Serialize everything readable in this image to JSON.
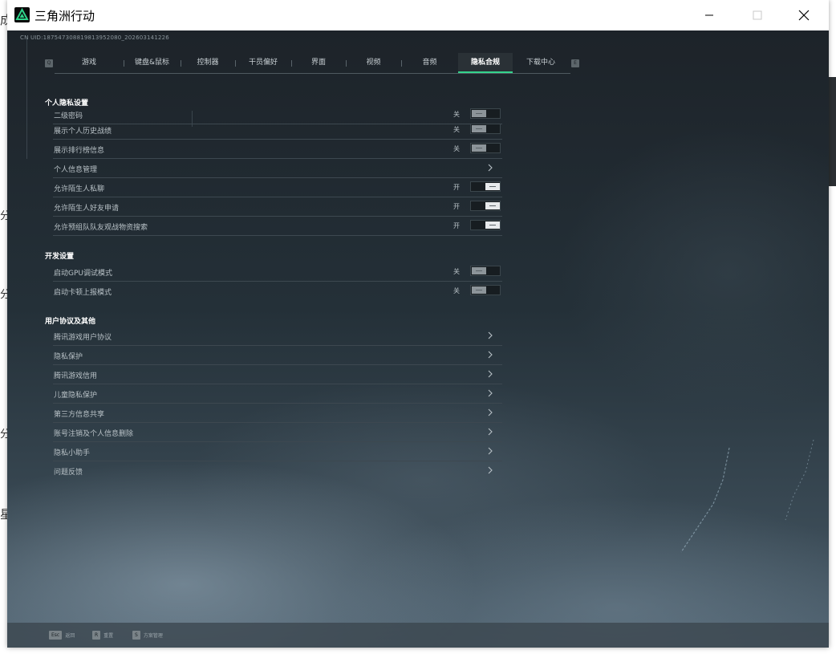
{
  "window": {
    "title": "三角洲行动"
  },
  "header": {
    "uid": "CN UID:18754730881981395208​0_2026031412​26"
  },
  "tabs": {
    "left_key": "Q",
    "right_key": "E",
    "items": [
      {
        "label": "游戏"
      },
      {
        "label": "键盘&鼠标"
      },
      {
        "label": "控制器"
      },
      {
        "label": "干员偏好"
      },
      {
        "label": "界面"
      },
      {
        "label": "视频"
      },
      {
        "label": "音频"
      },
      {
        "label": "隐私合规",
        "active": true
      },
      {
        "label": "下载中心"
      }
    ]
  },
  "sections": {
    "privacy": {
      "title": "个人隐私设置",
      "items": [
        {
          "label": "二级密码",
          "state": "关",
          "type": "toggle",
          "on": false
        },
        {
          "label": "展示个人历史战绩",
          "state": "关",
          "type": "toggle",
          "on": false
        },
        {
          "label": "展示排行榜信息",
          "state": "关",
          "type": "toggle",
          "on": false
        },
        {
          "label": "个人信息管理",
          "type": "link"
        },
        {
          "label": "允许陌生人私聊",
          "state": "开",
          "type": "toggle",
          "on": true
        },
        {
          "label": "允许陌生人好友申请",
          "state": "开",
          "type": "toggle",
          "on": true
        },
        {
          "label": "允许预组队队友观战物资搜索",
          "state": "开",
          "type": "toggle",
          "on": true
        }
      ]
    },
    "dev": {
      "title": "开发设置",
      "items": [
        {
          "label": "启动GPU调试模式",
          "state": "关",
          "type": "toggle",
          "on": false
        },
        {
          "label": "启动卡顿上报模式",
          "state": "关",
          "type": "toggle",
          "on": false
        }
      ]
    },
    "agreements": {
      "title": "用户协议及其他",
      "items": [
        {
          "label": "腾讯游戏用户协议"
        },
        {
          "label": "隐私保护"
        },
        {
          "label": "腾讯游戏信用"
        },
        {
          "label": "儿童隐私保护"
        },
        {
          "label": "第三方信息共享"
        },
        {
          "label": "账号注销及个人信息删除"
        },
        {
          "label": "隐私小助手"
        },
        {
          "label": "问题反馈"
        }
      ]
    }
  },
  "bottom": {
    "hints": [
      {
        "key": "Esc",
        "label": "返回"
      },
      {
        "key": "R",
        "label": "重置"
      },
      {
        "key": "S",
        "label": "方案管理"
      }
    ]
  },
  "colors": {
    "accent": "#34d38c",
    "panel": "#1f272e"
  }
}
